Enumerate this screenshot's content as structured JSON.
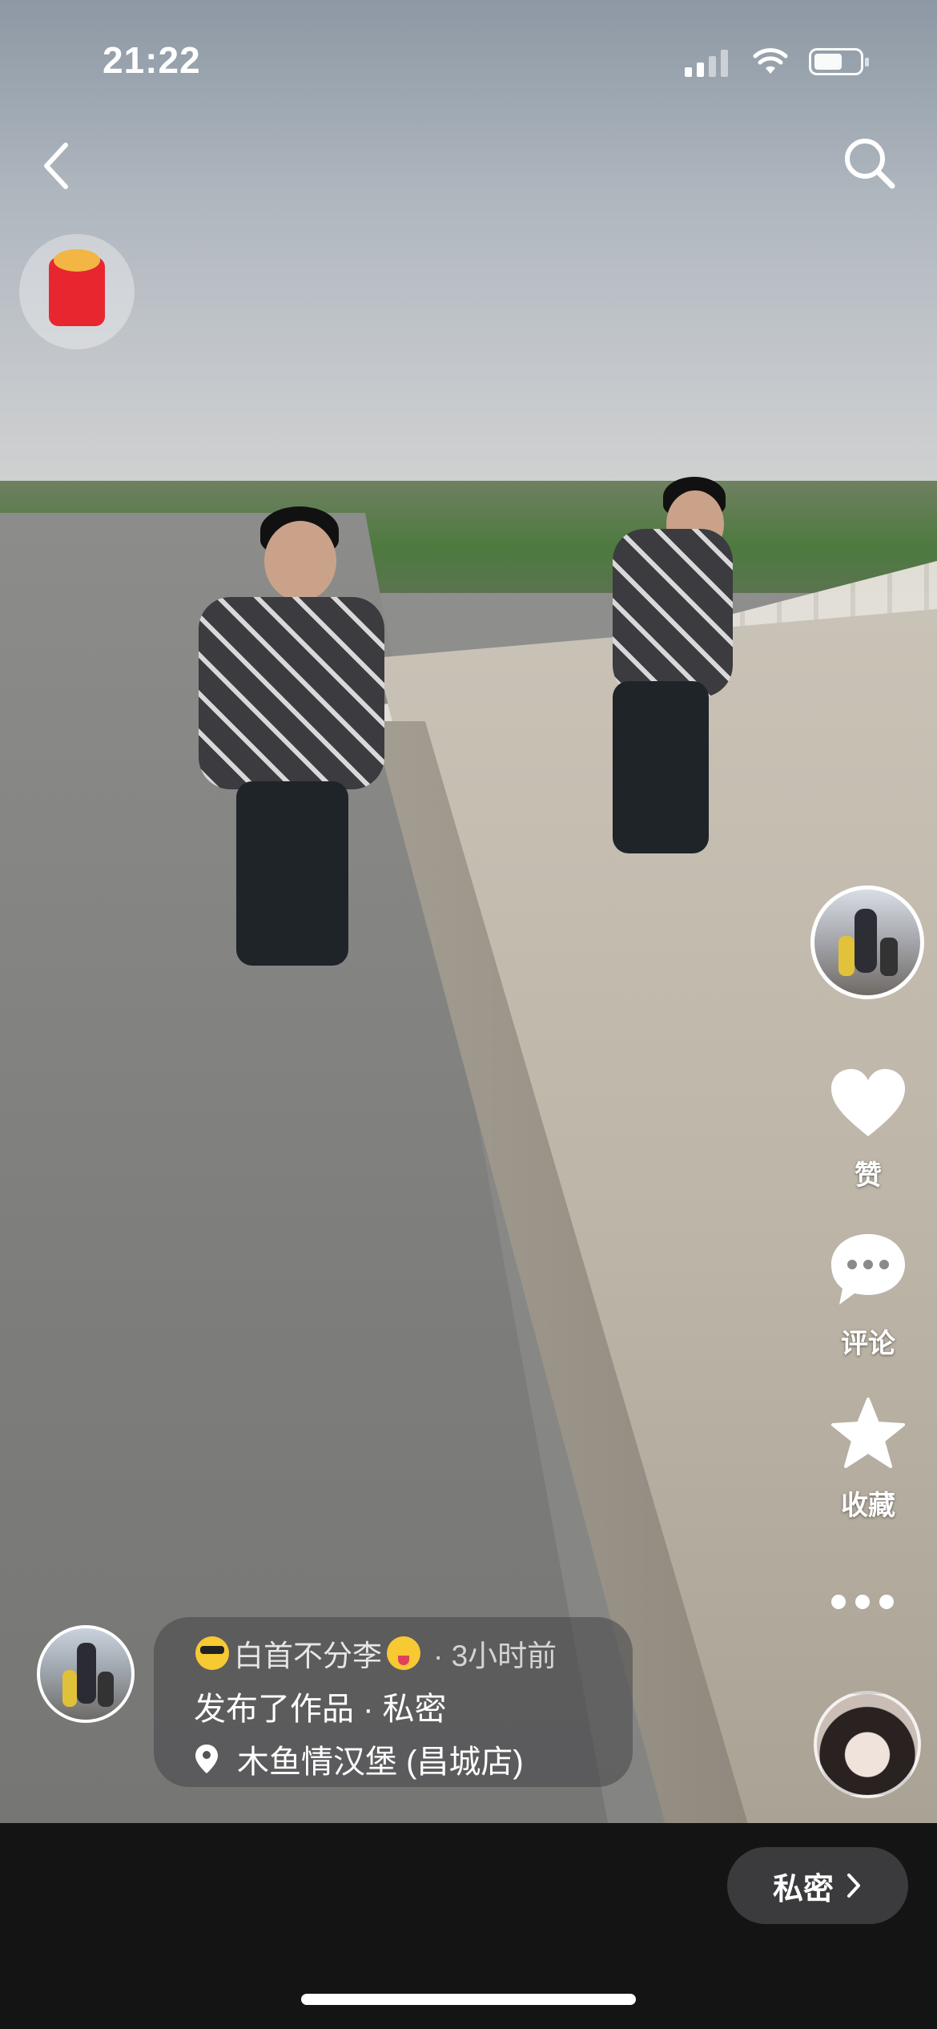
{
  "status_bar": {
    "time": "21:22"
  },
  "sidebar": {
    "like_label": "赞",
    "comment_label": "评论",
    "favorite_label": "收藏"
  },
  "post": {
    "author_name": "白首不分李",
    "time_ago": "· 3小时前",
    "activity": "发布了作品 · 私密",
    "location": "木鱼情汉堡 (昌城店)"
  },
  "bottom_bar": {
    "privacy_label": "私密"
  },
  "icons": {
    "back": "chevron-left-icon",
    "search": "search-icon",
    "red_packet": "red-packet-icon",
    "like": "heart-icon",
    "comment": "comment-bubble-icon",
    "favorite": "star-icon",
    "more": "more-dots-icon",
    "location": "location-pin-icon",
    "chevron_right": "chevron-right-icon"
  }
}
